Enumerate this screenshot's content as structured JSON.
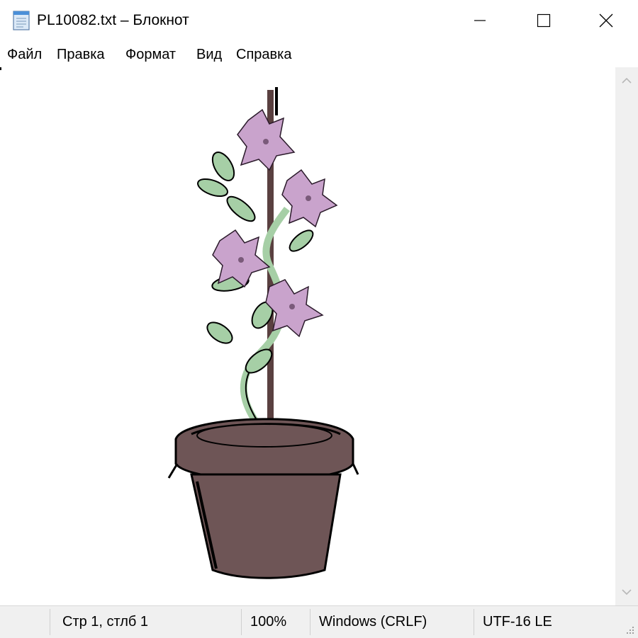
{
  "window": {
    "title": "PL10082.txt – Блокнот",
    "icon": "notepad-icon"
  },
  "caption_buttons": {
    "minimize": "minimize-icon",
    "maximize": "maximize-icon",
    "close": "close-icon"
  },
  "menu": {
    "items": [
      "Файл",
      "Правка",
      "Формат",
      "Вид",
      "Справка"
    ]
  },
  "editor": {
    "content_art": "potted flowering plant rendered as text art",
    "colors": {
      "petal": "#c9a3cc",
      "leaf": "#a6cfa6",
      "pot": "#6e5556",
      "outline": "#000000",
      "stake": "#5a4040"
    }
  },
  "statusbar": {
    "position": "Стр 1, стлб 1",
    "zoom": "100%",
    "line_endings": "Windows (CRLF)",
    "encoding": "UTF-16 LE"
  },
  "scrollbar": {
    "up_icon": "chevron-up-icon",
    "down_icon": "chevron-down-icon"
  }
}
